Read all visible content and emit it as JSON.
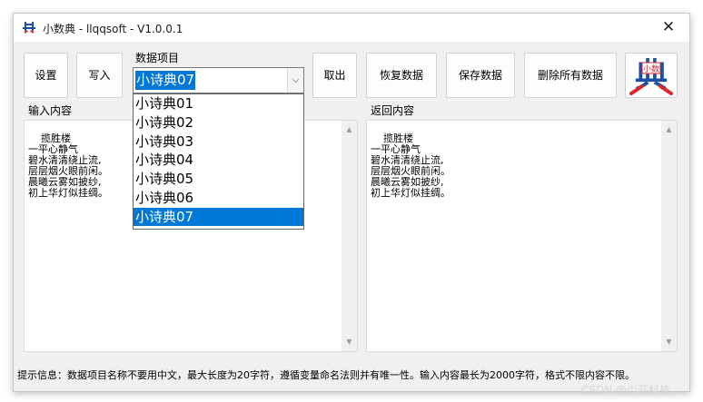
{
  "window": {
    "title": "小数典 - llqqsoft - V1.0.0.1",
    "close_glyph": "✕"
  },
  "toolbar": {
    "settings_label": "设置",
    "write_label": "写入",
    "fetch_label": "取出",
    "restore_label": "恢复数据",
    "save_label": "保存数据",
    "delete_all_label": "删除所有数据"
  },
  "data_item": {
    "group_label": "数据项目",
    "selected": "小诗典07",
    "options": [
      "小诗典01",
      "小诗典02",
      "小诗典03",
      "小诗典04",
      "小诗典05",
      "小诗典06",
      "小诗典07"
    ],
    "selected_index": 6
  },
  "input": {
    "label": "输入内容",
    "content": "揽胜楼\n一平心静气\n碧水清清绕止流,\n层层烟火眼前闲。\n晨曦云雾如披纱,\n初上华灯似挂绸。"
  },
  "output": {
    "label": "返回内容",
    "content": "揽胜楼\n一平心静气\n碧水清清绕止流,\n层层烟火眼前闲。\n晨曦云雾如披纱,\n初上华灯似挂绸。"
  },
  "status": {
    "text": "提示信息：数据项目名称不要用中文，最大长度为20字符，遵循变量命名法则并有唯一性。输入内容最长为2000字符，格式不限内容不限。"
  },
  "logo": {
    "big_char": "典",
    "small_text": "小数"
  },
  "watermark": "CSDN @少莊科技",
  "colors": {
    "accent": "#0078d7",
    "logo_red": "#d9262b",
    "logo_blue": "#1f4fa3"
  },
  "icons": {
    "app": "app-logo-icon",
    "close": "close-icon",
    "combo_arrow": "chevron-down-icon"
  }
}
